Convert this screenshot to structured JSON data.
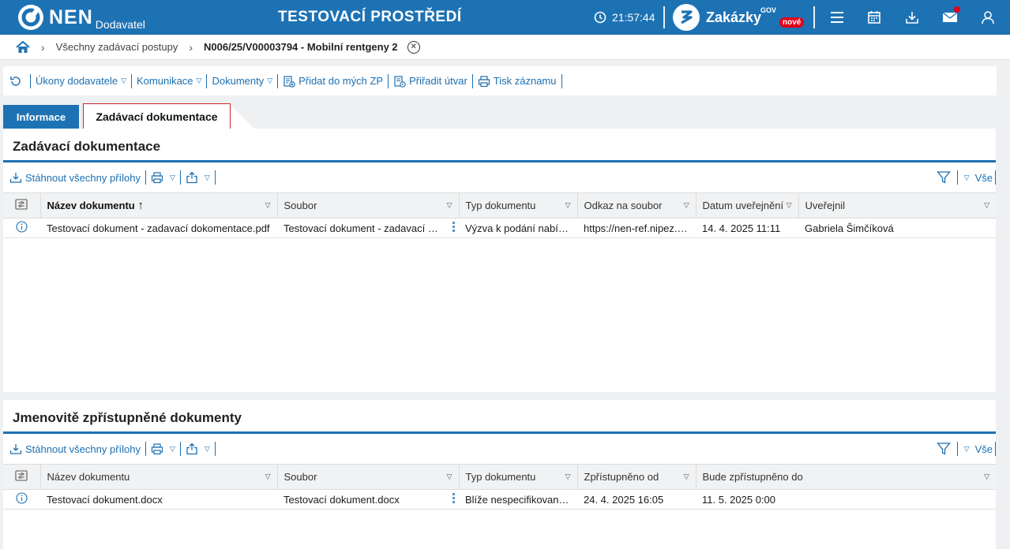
{
  "header": {
    "logo_text": "NEN",
    "logo_sub": "Dodavatel",
    "environment_title": "TESTOVACÍ PROSTŘEDÍ",
    "clock": "21:57:44",
    "zakazky_label": "Zakázky",
    "zakazky_sup": "GOV",
    "zakazky_badge": "nové"
  },
  "breadcrumb": {
    "items": [
      "Všechny zadávací postupy"
    ],
    "current": "N006/25/V00003794 - Mobilní rentgeny 2"
  },
  "actionbar": {
    "items": [
      {
        "label": "Úkony dodavatele",
        "dropdown": true
      },
      {
        "label": "Komunikace",
        "dropdown": true
      },
      {
        "label": "Dokumenty",
        "dropdown": true
      },
      {
        "label": "Přidat do mých ZP",
        "dropdown": false
      },
      {
        "label": "Přiřadit útvar",
        "dropdown": false
      },
      {
        "label": "Tisk záznamu",
        "dropdown": false
      }
    ]
  },
  "tabs": {
    "info": "Informace",
    "active": "Zadávací dokumentace"
  },
  "panel1": {
    "title": "Zadávací dokumentace",
    "download_all": "Stáhnout všechny přílohy",
    "filter_all": "Vše",
    "columns": [
      "Název dokumentu",
      "Soubor",
      "Typ dokumentu",
      "Odkaz na soubor",
      "Datum uveřejnění",
      "Uveřejnil"
    ],
    "rows": [
      [
        "Testovací dokument - zadavací dokomentace.pdf",
        "Testovací dokument - zadavací dokomentace.pdf",
        "Výzva k podání nabídky",
        "https://nen-ref.nipez.cz/",
        "14. 4. 2025 11:11",
        "Gabriela Šimčíková"
      ]
    ]
  },
  "panel2": {
    "title": "Jmenovitě zpřístupněné dokumenty",
    "download_all": "Stáhnout všechny přílohy",
    "filter_all": "Vše",
    "columns": [
      "Název dokumentu",
      "Soubor",
      "Typ dokumentu",
      "Zpřístupněno od",
      "Bude zpřístupněno do"
    ],
    "rows": [
      [
        "Testovací dokument.docx",
        "Testovací dokument.docx",
        "Blíže nespecifikovaný dokument",
        "24. 4. 2025 16:05",
        "11. 5. 2025 0:00"
      ]
    ]
  }
}
